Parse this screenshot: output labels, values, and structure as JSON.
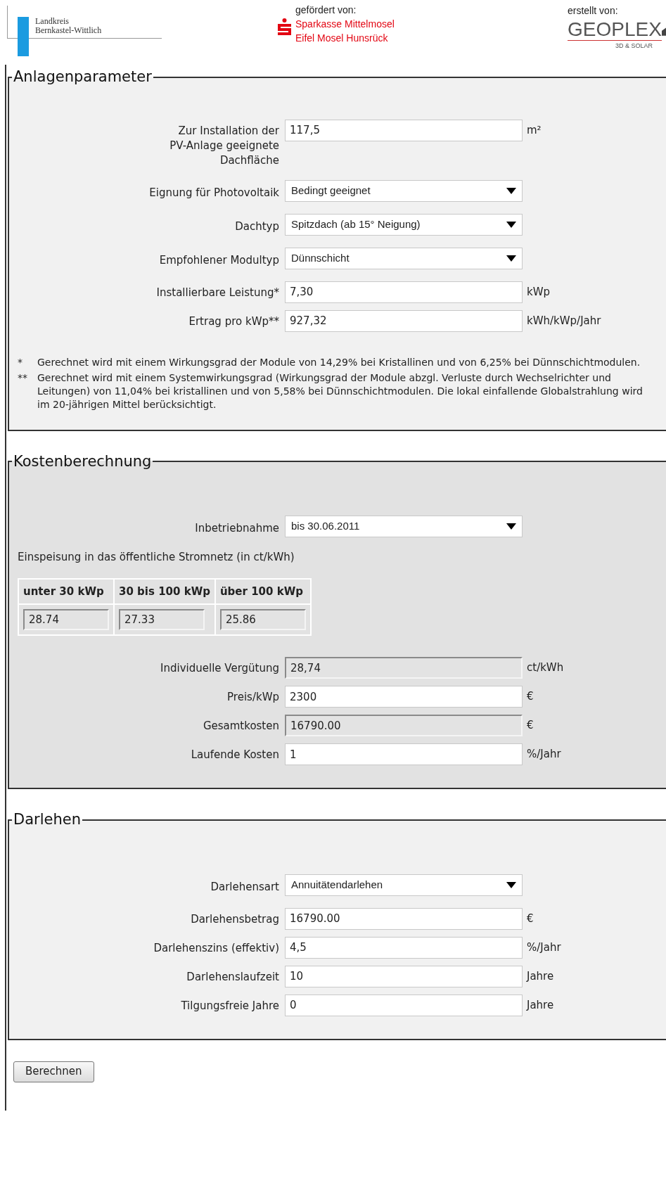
{
  "header": {
    "district": {
      "lines": [
        "Landkreis",
        "Bernkastel-Wittlich"
      ]
    },
    "sponsor": {
      "label": "gefördert von:",
      "lines": [
        "Sparkasse Mittelmosel",
        "Eifel Mosel Hunsrück"
      ]
    },
    "creator": {
      "label": "erstellt von:",
      "logo": "GEOPLEX",
      "tagline": "3D & SOLAR"
    }
  },
  "sections": [
    {
      "legend": "Anlagenparameter",
      "shaded": false,
      "items": [
        {
          "kind": "input",
          "label": "Zur Installation der\nPV-Anlage geeignete\nDachfläche",
          "value": "117,5",
          "unit": "m²"
        },
        {
          "kind": "select",
          "label": "Eignung für Photovoltaik",
          "value": "Bedingt geeignet"
        },
        {
          "kind": "select",
          "label": "Dachtyp",
          "value": "Spitzdach (ab 15° Neigung)"
        },
        {
          "kind": "select",
          "label": "Empfohlener Modultyp",
          "value": "Dünnschicht"
        },
        {
          "kind": "input",
          "label": "Installierbare Leistung*",
          "value": "7,30",
          "unit": "kWp"
        },
        {
          "kind": "input",
          "label": "Ertrag pro kWp**",
          "value": "927,32",
          "unit": "kWh/kWp/Jahr"
        },
        {
          "kind": "notes",
          "notes": [
            {
              "mark": "*",
              "text": "Gerechnet wird mit einem Wirkungsgrad der Module von 14,29% bei Kristallinen und von 6,25% bei Dünnschichtmodulen."
            },
            {
              "mark": "**",
              "text": "Gerechnet wird mit einem Systemwirkungsgrad (Wirkungsgrad der Module abzgl. Verluste durch Wechselrichter und Leitungen) von 11,04% bei kristallinen und von 5,58% bei Dünnschichtmodulen. Die lokal einfallende Globalstrahlung wird im 20-jährigen Mittel berücksichtigt."
            }
          ]
        }
      ]
    },
    {
      "legend": "Kostenberechnung",
      "shaded": true,
      "items": [
        {
          "kind": "select",
          "label": "Inbetriebnahme",
          "value": "bis 30.06.2011"
        },
        {
          "kind": "text",
          "text": "Einspeisung in das öffentliche Stromnetz (in ct/kWh)"
        },
        {
          "kind": "table",
          "columns": [
            "unter 30 kWp",
            "30 bis 100 kWp",
            "über 100 kWp"
          ],
          "values": [
            "28.74",
            "27.33",
            "25.86"
          ]
        },
        {
          "kind": "readonly",
          "label": "Individuelle Vergütung",
          "value": "28,74",
          "unit": "ct/kWh"
        },
        {
          "kind": "input",
          "label": "Preis/kWp",
          "value": "2300",
          "unit": "€"
        },
        {
          "kind": "readonly",
          "label": "Gesamtkosten",
          "value": "16790.00",
          "unit": "€"
        },
        {
          "kind": "input",
          "label": "Laufende Kosten",
          "value": "1",
          "unit": "%/Jahr"
        }
      ]
    },
    {
      "legend": "Darlehen",
      "shaded": false,
      "items": [
        {
          "kind": "select",
          "label": "Darlehensart",
          "value": "Annuitätendarlehen"
        },
        {
          "kind": "input",
          "label": "Darlehensbetrag",
          "value": "16790.00",
          "unit": "€"
        },
        {
          "kind": "input",
          "label": "Darlehenszins (effektiv)",
          "value": "4,5",
          "unit": "%/Jahr"
        },
        {
          "kind": "input",
          "label": "Darlehenslaufzeit",
          "value": "10",
          "unit": "Jahre"
        },
        {
          "kind": "input",
          "label": "Tilgungsfreie Jahre",
          "value": "0",
          "unit": "Jahre"
        }
      ]
    }
  ],
  "submit": "Berechnen"
}
